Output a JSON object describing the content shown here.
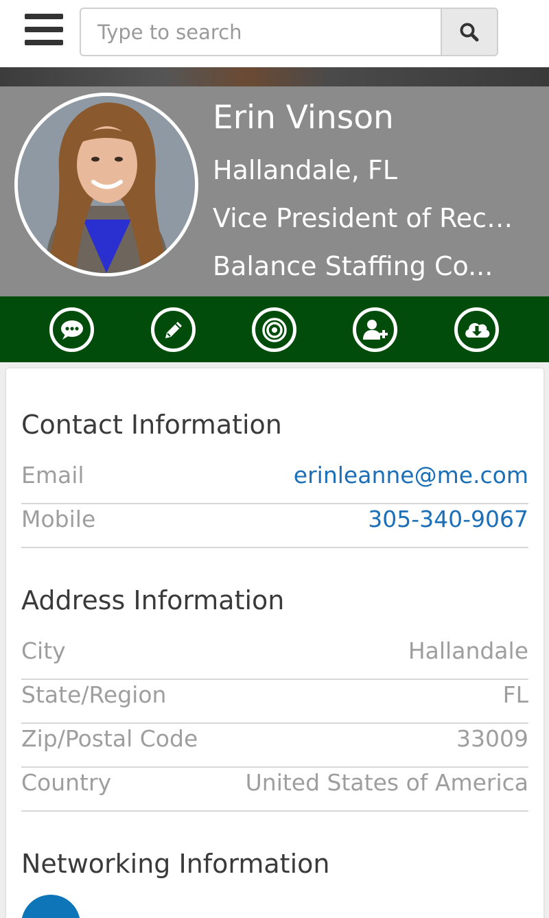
{
  "search": {
    "placeholder": "Type to search"
  },
  "profile": {
    "name": "Erin Vinson",
    "location": "Hallandale, FL",
    "title": "Vice President of Recr...",
    "company": "Balance Staffing Co..."
  },
  "colors": {
    "header_bg": "#8b8b8b",
    "action_bar_bg": "#024c0b",
    "link": "#1a6fb8",
    "linkedin": "#0e76b8"
  },
  "actions": [
    {
      "icon": "chat-icon"
    },
    {
      "icon": "edit-icon"
    },
    {
      "icon": "target-icon"
    },
    {
      "icon": "add-contact-icon"
    },
    {
      "icon": "cloud-download-icon"
    }
  ],
  "contact": {
    "title": "Contact Information",
    "email_label": "Email",
    "email_value": "erinleanne@me.com",
    "mobile_label": "Mobile",
    "mobile_value": "305-340-9067"
  },
  "address": {
    "title": "Address Information",
    "city_label": "City",
    "city_value": "Hallandale",
    "state_label": "State/Region",
    "state_value": "FL",
    "zip_label": "Zip/Postal Code",
    "zip_value": "33009",
    "country_label": "Country",
    "country_value": "United States of America"
  },
  "networking": {
    "title": "Networking Information"
  }
}
